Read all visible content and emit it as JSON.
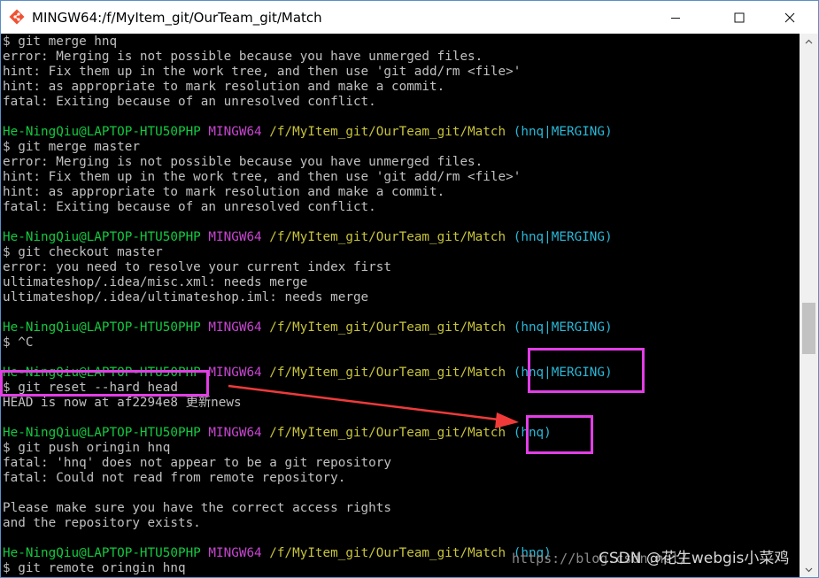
{
  "window": {
    "title": "MINGW64:/f/MyItem_git/OurTeam_git/Match"
  },
  "terminal": {
    "lines": [
      {
        "type": "out",
        "text": "$ git merge hnq"
      },
      {
        "type": "out",
        "text": "error: Merging is not possible because you have unmerged files."
      },
      {
        "type": "out",
        "text": "hint: Fix them up in the work tree, and then use 'git add/rm <file>'"
      },
      {
        "type": "out",
        "text": "hint: as appropriate to mark resolution and make a commit."
      },
      {
        "type": "out",
        "text": "fatal: Exiting because of an unresolved conflict."
      },
      {
        "type": "out",
        "text": ""
      },
      {
        "type": "prompt",
        "user": "He-NingQiu@LAPTOP-HTU50PHP",
        "host": "MINGW64",
        "path": "/f/MyItem_git/OurTeam_git/Match",
        "branch": "(hnq|MERGING)"
      },
      {
        "type": "out",
        "text": "$ git merge master"
      },
      {
        "type": "out",
        "text": "error: Merging is not possible because you have unmerged files."
      },
      {
        "type": "out",
        "text": "hint: Fix them up in the work tree, and then use 'git add/rm <file>'"
      },
      {
        "type": "out",
        "text": "hint: as appropriate to mark resolution and make a commit."
      },
      {
        "type": "out",
        "text": "fatal: Exiting because of an unresolved conflict."
      },
      {
        "type": "out",
        "text": ""
      },
      {
        "type": "prompt",
        "user": "He-NingQiu@LAPTOP-HTU50PHP",
        "host": "MINGW64",
        "path": "/f/MyItem_git/OurTeam_git/Match",
        "branch": "(hnq|MERGING)"
      },
      {
        "type": "out",
        "text": "$ git checkout master"
      },
      {
        "type": "out",
        "text": "error: you need to resolve your current index first"
      },
      {
        "type": "out",
        "text": "ultimateshop/.idea/misc.xml: needs merge"
      },
      {
        "type": "out",
        "text": "ultimateshop/.idea/ultimateshop.iml: needs merge"
      },
      {
        "type": "out",
        "text": ""
      },
      {
        "type": "prompt",
        "user": "He-NingQiu@LAPTOP-HTU50PHP",
        "host": "MINGW64",
        "path": "/f/MyItem_git/OurTeam_git/Match",
        "branch": "(hnq|MERGING)"
      },
      {
        "type": "out",
        "text": "$ ^C"
      },
      {
        "type": "out",
        "text": ""
      },
      {
        "type": "prompt",
        "user": "He-NingQiu@LAPTOP-HTU50PHP",
        "host": "MINGW64",
        "path": "/f/MyItem_git/OurTeam_git/Match",
        "branch": "(hnq|MERGING)"
      },
      {
        "type": "out",
        "text": "$ git reset --hard head"
      },
      {
        "type": "out",
        "text": "HEAD is now at af2294e8 更新news"
      },
      {
        "type": "out",
        "text": ""
      },
      {
        "type": "prompt",
        "user": "He-NingQiu@LAPTOP-HTU50PHP",
        "host": "MINGW64",
        "path": "/f/MyItem_git/OurTeam_git/Match",
        "branch": "(hnq)"
      },
      {
        "type": "out",
        "text": "$ git push oringin hnq"
      },
      {
        "type": "out",
        "text": "fatal: 'hnq' does not appear to be a git repository"
      },
      {
        "type": "out",
        "text": "fatal: Could not read from remote repository."
      },
      {
        "type": "out",
        "text": ""
      },
      {
        "type": "out",
        "text": "Please make sure you have the correct access rights"
      },
      {
        "type": "out",
        "text": "and the repository exists."
      },
      {
        "type": "out",
        "text": ""
      },
      {
        "type": "prompt",
        "user": "He-NingQiu@LAPTOP-HTU50PHP",
        "host": "MINGW64",
        "path": "/f/MyItem_git/OurTeam_git/Match",
        "branch": "(hnq)"
      },
      {
        "type": "out",
        "text": "$ git remote oringin hnq"
      }
    ]
  },
  "watermark": {
    "url": "https://blog.csdn.net/",
    "brand": "CSDN @花生webgis小菜鸡"
  },
  "colors": {
    "annotation": "#e23ee6",
    "user": "#13c940",
    "host": "#c745d0",
    "path": "#c8c43a",
    "branch": "#28b8d8"
  }
}
